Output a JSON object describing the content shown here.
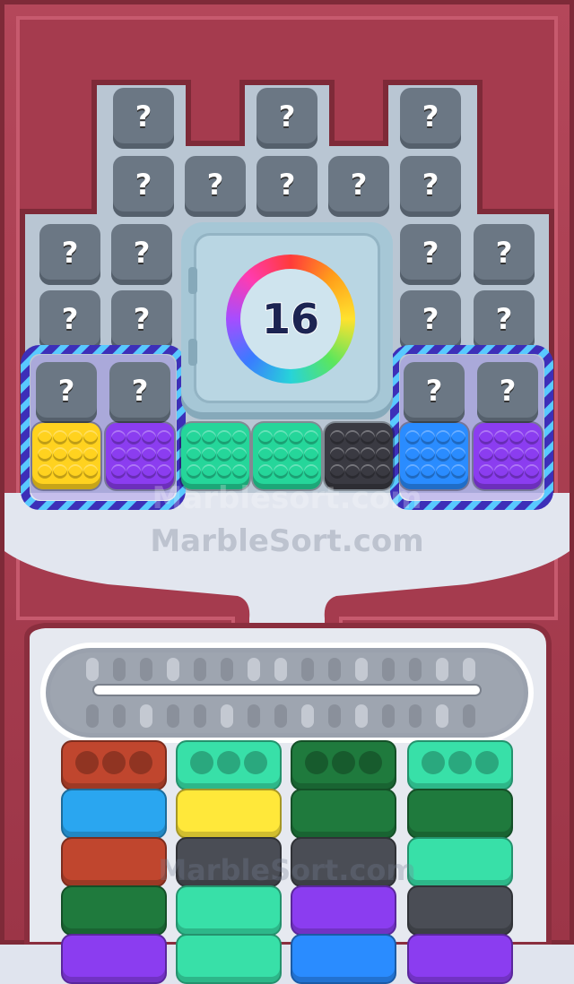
{
  "timer": {
    "value": "16"
  },
  "question_mark": "?",
  "watermarks": [
    "Marblesort.com",
    "MarbleSort.com"
  ],
  "colors": {
    "frame": "#a23a4a",
    "board": "#b9c6d3",
    "question_block": "#6b7784",
    "tray": "#e2e6ef"
  },
  "marble_blocks": [
    {
      "color": "yellow",
      "hex": "#ffd21f"
    },
    {
      "color": "purple",
      "hex": "#8b3df0"
    },
    {
      "color": "green",
      "hex": "#25d69a"
    },
    {
      "color": "green",
      "hex": "#25d69a"
    },
    {
      "color": "black",
      "hex": "#3a3a42"
    },
    {
      "color": "blue",
      "hex": "#2a8cff"
    },
    {
      "color": "purple",
      "hex": "#8b3df0"
    }
  ],
  "conveyor_slots": {
    "top_row": [
      "empty",
      "filled",
      "filled",
      "empty",
      "filled",
      "filled",
      "empty",
      "empty",
      "filled",
      "filled",
      "empty",
      "filled",
      "filled",
      "empty",
      "empty"
    ],
    "bottom_row": [
      "filled",
      "filled",
      "empty",
      "filled",
      "filled",
      "empty",
      "filled",
      "filled",
      "empty",
      "filled",
      "empty",
      "filled",
      "filled",
      "empty",
      "filled"
    ]
  },
  "tube_columns": [
    {
      "tubes": [
        {
          "hex": "#c0462e",
          "holes": true
        },
        {
          "hex": "#2aa6f0"
        },
        {
          "hex": "#c0462e"
        },
        {
          "hex": "#1f7a3d"
        },
        {
          "hex": "#8b3df0"
        }
      ]
    },
    {
      "tubes": [
        {
          "hex": "#38e0a8",
          "holes": true
        },
        {
          "hex": "#ffe83a"
        },
        {
          "hex": "#4a4d55"
        },
        {
          "hex": "#38e0a8"
        },
        {
          "hex": "#38e0a8"
        }
      ]
    },
    {
      "tubes": [
        {
          "hex": "#1f7a3d",
          "holes": true
        },
        {
          "hex": "#1f7a3d"
        },
        {
          "hex": "#4a4d55"
        },
        {
          "hex": "#8b3df0"
        },
        {
          "hex": "#2a8cff"
        }
      ]
    },
    {
      "tubes": [
        {
          "hex": "#38e0a8",
          "holes": true
        },
        {
          "hex": "#1f7a3d"
        },
        {
          "hex": "#38e0a8"
        },
        {
          "hex": "#4a4d55"
        },
        {
          "hex": "#8b3df0"
        }
      ]
    }
  ]
}
